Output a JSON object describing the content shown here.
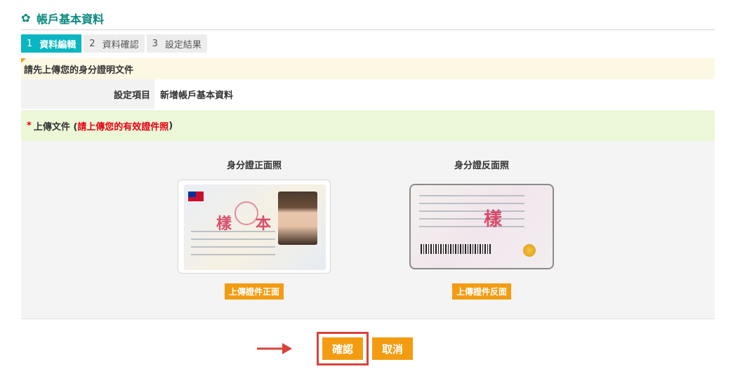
{
  "page": {
    "title": "帳戶基本資料"
  },
  "steps": [
    {
      "num": "1",
      "label": "資料編輯",
      "active": true
    },
    {
      "num": "2",
      "label": "資料確認",
      "active": false
    },
    {
      "num": "3",
      "label": "設定結果",
      "active": false
    }
  ],
  "notice": "請先上傳您的身分證明文件",
  "setting": {
    "label": "設定項目",
    "value": "新增帳戶基本資料"
  },
  "upload": {
    "star": "*",
    "label": "上傳文件 (",
    "hint": "請上傳您的有效證件照",
    "close": ")"
  },
  "cards": {
    "front": {
      "caption": "身分證正面照",
      "button": "上傳證件正面",
      "mark1": "樣",
      "mark2": "本"
    },
    "back": {
      "caption": "身分證反面照",
      "button": "上傳證件反面"
    }
  },
  "actions": {
    "confirm": "確認",
    "cancel": "取消"
  },
  "colors": {
    "accent": "#0a8a7e",
    "step_active": "#0ab6c2",
    "button": "#f39c12",
    "highlight": "#d9433b"
  }
}
